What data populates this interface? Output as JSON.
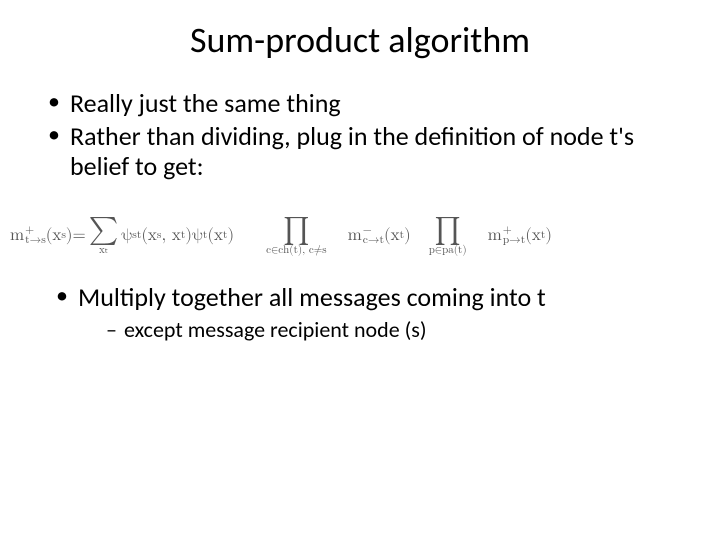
{
  "title": "Sum-product algorithm",
  "bullets_top": [
    "Really just the same thing",
    "Rather than dividing, plug in the definition of node t's belief to get:"
  ],
  "formula": {
    "lhs_m": "m",
    "lhs_sup": "+",
    "lhs_sub": "t→s",
    "lhs_arg": "(x",
    "lhs_arg_sub": "s",
    "lhs_arg_close": ")",
    "eq": " = ",
    "sum_sym": "∑",
    "sum_sub": "xₜ",
    "psi_st": "ψ",
    "psi_st_sub": "st",
    "psi_st_args": "(x",
    "psi_st_a1": "s",
    "psi_st_comma": ", x",
    "psi_st_a2": "t",
    "psi_st_close": ")",
    "psi_t": "ψ",
    "psi_t_sub": "t",
    "psi_t_args": "(x",
    "psi_t_a": "t",
    "psi_t_close": ")",
    "prod1_sym": "∏",
    "prod1_sub": "c∈ch(t), c≠s",
    "m1": "m",
    "m1_sup": "−",
    "m1_sub": "c→t",
    "m1_args": "(x",
    "m1_a": "t",
    "m1_close": ")",
    "prod2_sym": "∏",
    "prod2_sub": "p∈pa(t)",
    "m2": "m",
    "m2_sup": "+",
    "m2_sub": "p→t",
    "m2_args": "(x",
    "m2_a": "t",
    "m2_close": ")"
  },
  "bullets_bottom": [
    "Multiply together all messages coming into t"
  ],
  "sub_dash": [
    "except message recipient node (s)"
  ]
}
